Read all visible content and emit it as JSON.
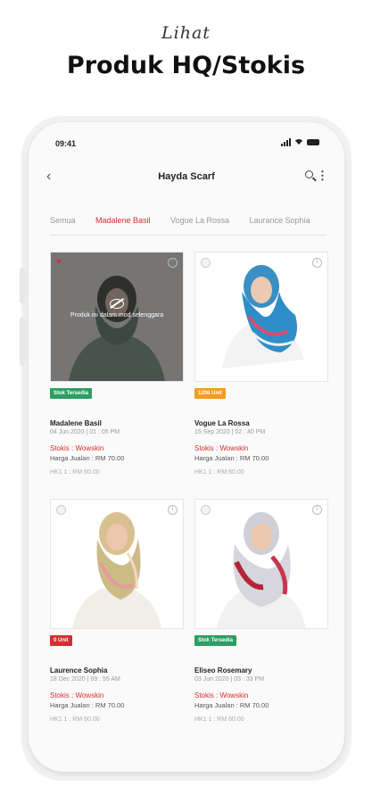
{
  "promo": {
    "script": "Lihat",
    "title": "Produk HQ/Stokis"
  },
  "status_bar": {
    "time": "09:41",
    "icons": [
      "signal-icon",
      "wifi-icon",
      "battery-icon"
    ]
  },
  "app_bar": {
    "title": "Hayda Scarf",
    "back_icon": "chevron-left-icon",
    "search_icon": "search-icon",
    "more_icon": "more-vertical-icon"
  },
  "tabs": [
    {
      "label": "Semua",
      "active": false
    },
    {
      "label": "Madalene Basil",
      "active": true
    },
    {
      "label": "Vogue La Rossa",
      "active": false
    },
    {
      "label": "Laurance Sophia",
      "active": false
    }
  ],
  "products": [
    {
      "name": "Madalene Basil",
      "date": "04 Jun 2020 | 01 : 05 PM",
      "stokis": "Stokis : Wowskin",
      "price": "Harga Jualan : RM 70.00",
      "hk": "HK1 1  :  RM 60.00",
      "badge": "Stok Tersedia",
      "badge_color": "#2e9e62",
      "favorite": true,
      "unavailable": true,
      "overlay_text": "Produk ini dalam mod selenggara",
      "image_icon": "hijab-model-image"
    },
    {
      "name": "Vogue La Rossa",
      "date": "15 Sep 2020 | 02 : 40 PM",
      "stokis": "Stokis : Wowskin",
      "price": "Harga Jualan : RM 70.00",
      "hk": "HK1 1  :  RM 60.00",
      "badge": "1206 Unit",
      "badge_color": "#f39c23",
      "favorite": false,
      "unavailable": false,
      "image_icon": "hijab-model-image"
    },
    {
      "name": "Laurence Sophia",
      "date": "18 Dec 2020 | 09 : 55 AM",
      "stokis": "Stokis : Wowskin",
      "price": "Harga Jualan : RM 70.00",
      "hk": "HK1 1  :  RM 60.00",
      "badge": "0 Unit",
      "badge_color": "#d32f2f",
      "favorite": false,
      "unavailable": false,
      "image_icon": "hijab-model-image"
    },
    {
      "name": "Eliseo Rosemary",
      "date": "03 Jun 2020 | 03 : 33 PM",
      "stokis": "Stokis : Wowskin",
      "price": "Harga Jualan : RM 70.00",
      "hk": "HK1 1  :  RM 60.00",
      "badge": "Stok Tersedia",
      "badge_color": "#2e9e62",
      "favorite": false,
      "unavailable": false,
      "image_icon": "hijab-model-image"
    }
  ],
  "colors": {
    "accent": "#d32f2f",
    "in_stock": "#2e9e62",
    "units": "#f39c23"
  }
}
